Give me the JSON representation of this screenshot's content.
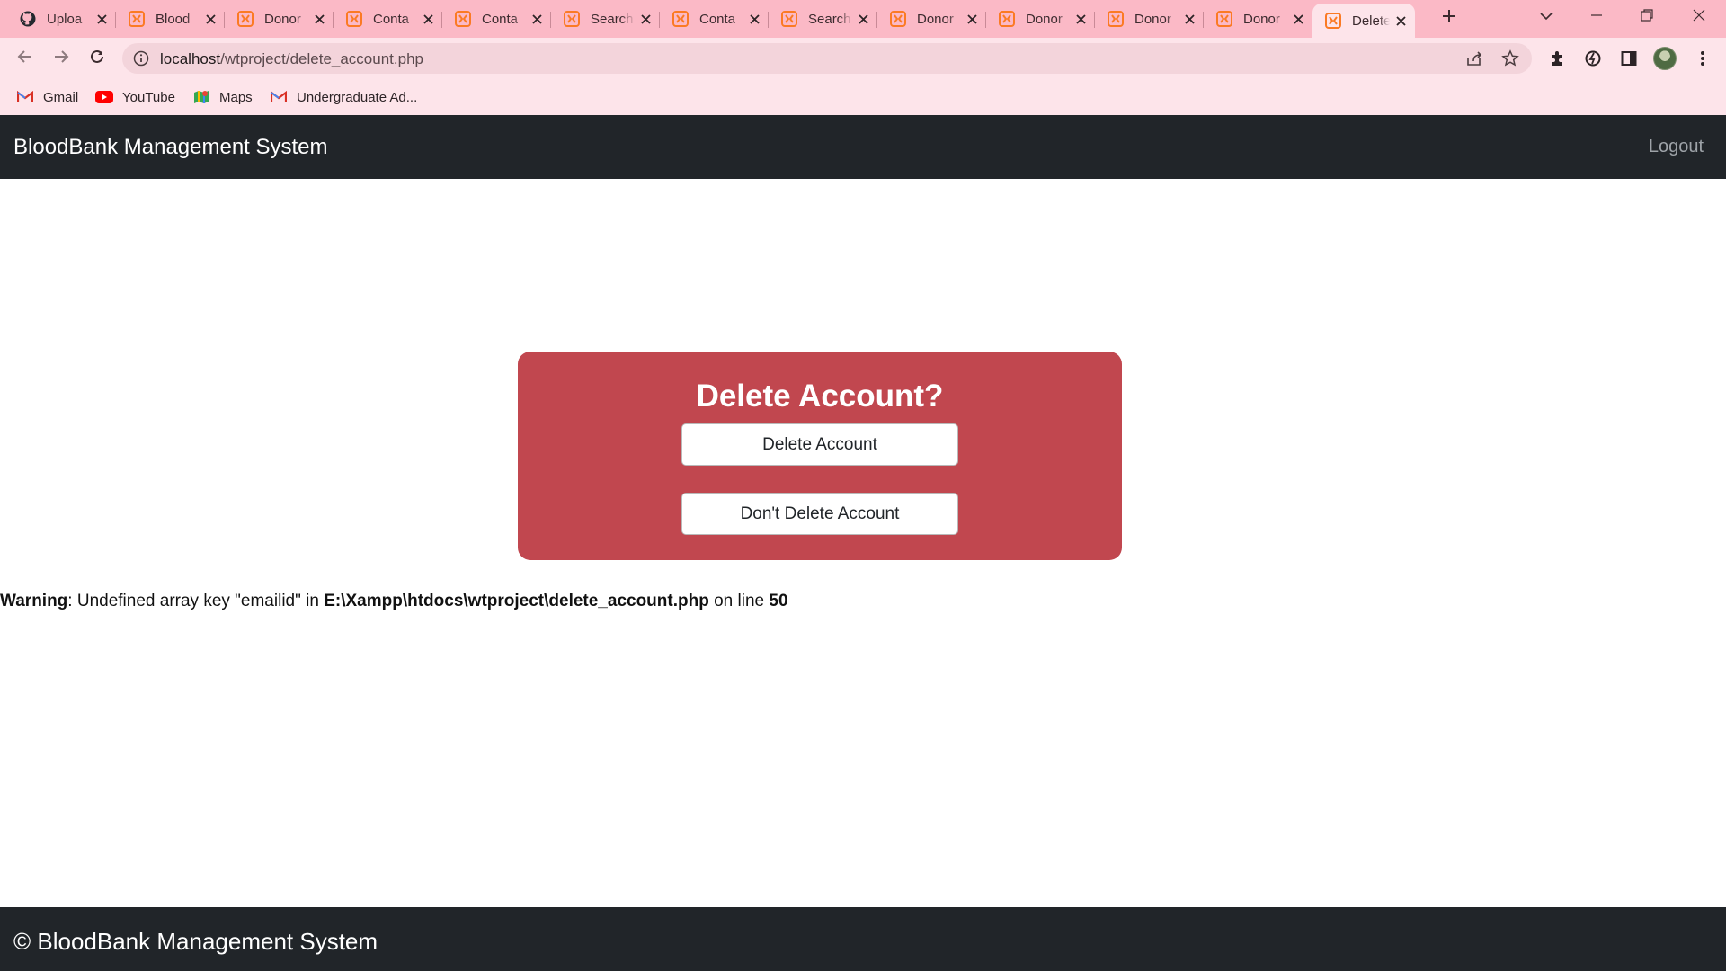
{
  "browser": {
    "tabs": [
      {
        "title": "Uploa",
        "icon": "github-icon"
      },
      {
        "title": "Blood",
        "icon": "xampp-icon"
      },
      {
        "title": "Donor",
        "icon": "xampp-icon"
      },
      {
        "title": "Conta",
        "icon": "xampp-icon"
      },
      {
        "title": "Conta",
        "icon": "xampp-icon"
      },
      {
        "title": "Search",
        "icon": "xampp-icon"
      },
      {
        "title": "Conta",
        "icon": "xampp-icon"
      },
      {
        "title": "Search",
        "icon": "xampp-icon"
      },
      {
        "title": "Donor",
        "icon": "xampp-icon"
      },
      {
        "title": "Donor",
        "icon": "xampp-icon"
      },
      {
        "title": "Donor",
        "icon": "xampp-icon"
      },
      {
        "title": "Donor",
        "icon": "xampp-icon"
      },
      {
        "title": "Delete",
        "icon": "xampp-icon",
        "active": true
      }
    ],
    "url_host": "localhost",
    "url_path": "/wtproject/delete_account.php",
    "bookmarks": [
      {
        "label": "Gmail",
        "icon": "gmail-icon"
      },
      {
        "label": "YouTube",
        "icon": "youtube-icon"
      },
      {
        "label": "Maps",
        "icon": "maps-icon"
      },
      {
        "label": "Undergraduate Ad...",
        "icon": "gmail-icon"
      }
    ],
    "colors": {
      "tabstrip": "#fbb9c6",
      "toolbar": "#fde4ea"
    }
  },
  "page": {
    "brand": "BloodBank Management System",
    "logout_label": "Logout",
    "card": {
      "heading": "Delete Account?",
      "delete_label": "Delete Account",
      "keep_label": "Don't Delete Account",
      "color": "#c1474f"
    },
    "warning": {
      "label": "Warning",
      "message_pre": ": Undefined array key \"emailid\" in ",
      "file": "E:\\Xampp\\htdocs\\wtproject\\delete_account.php",
      "message_mid": " on line ",
      "line": "50"
    },
    "footer": "© BloodBank Management System"
  }
}
